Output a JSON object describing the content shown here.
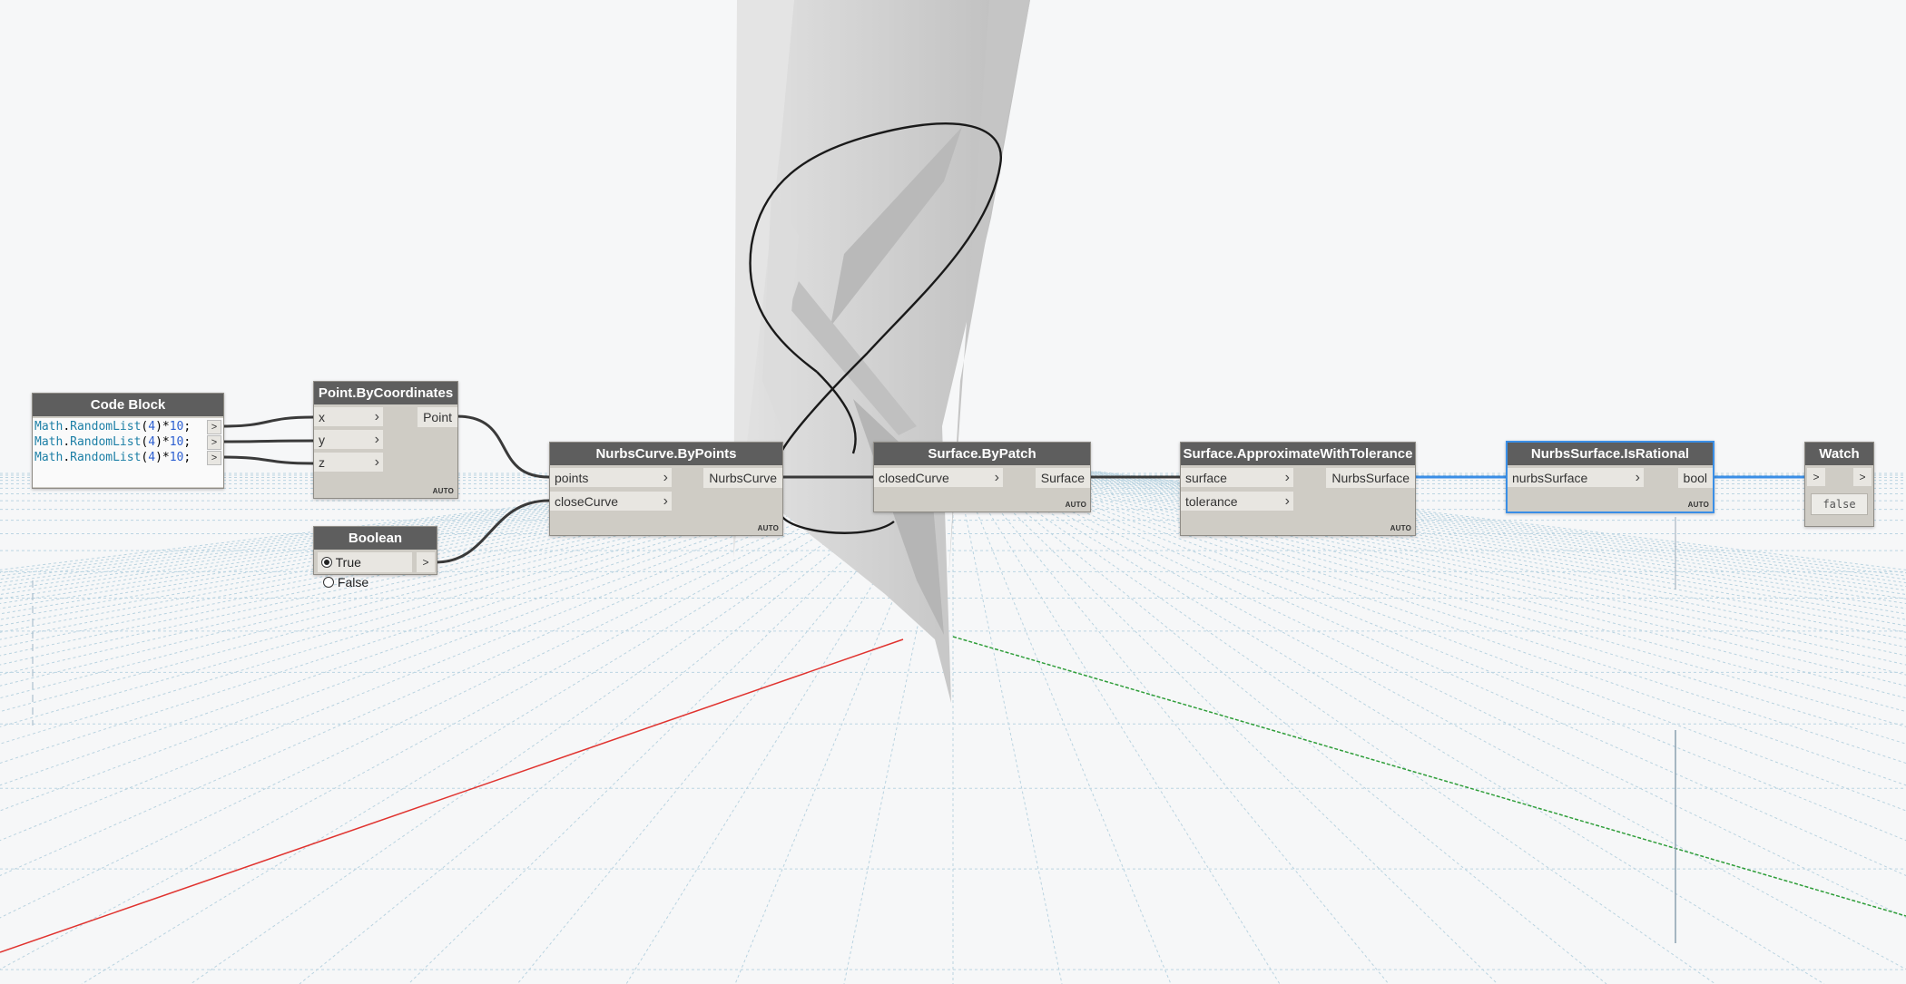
{
  "colors": {
    "node_header": "#5e5e5e",
    "node_body": "#cfccc5",
    "port_fill": "#e8e6e1",
    "wire": "#3a3a3a",
    "selected_wire": "#3a8ee6",
    "code_function": "#1c7fa6",
    "code_number": "#2c5fd1",
    "x_axis": "#e0332f",
    "y_axis": "#2f9e3a",
    "grid": "#9fc3d6"
  },
  "nodes": {
    "code_block": {
      "title": "Code Block",
      "lines": [
        {
          "fn": "Math",
          "dot": ".",
          "method": "RandomList",
          "open": "(",
          "arg": "4",
          "close": ")",
          "op": "*",
          "num": "10",
          "end": ";"
        },
        {
          "fn": "Math",
          "dot": ".",
          "method": "RandomList",
          "open": "(",
          "arg": "4",
          "close": ")",
          "op": "*",
          "num": "10",
          "end": ";"
        },
        {
          "fn": "Math",
          "dot": ".",
          "method": "RandomList",
          "open": "(",
          "arg": "4",
          "close": ")",
          "op": "*",
          "num": "10",
          "end": ";"
        }
      ],
      "output_glyph": ">"
    },
    "point_by_coordinates": {
      "title": "Point.ByCoordinates",
      "inputs": [
        "x",
        "y",
        "z"
      ],
      "output": "Point",
      "lacing": "AUTO"
    },
    "boolean": {
      "title": "Boolean",
      "true_label": "True",
      "false_label": "False",
      "selected": "True",
      "output_glyph": ">"
    },
    "nurbs_curve": {
      "title": "NurbsCurve.ByPoints",
      "inputs": [
        "points",
        "closeCurve"
      ],
      "output": "NurbsCurve",
      "lacing": "AUTO"
    },
    "surface_by_patch": {
      "title": "Surface.ByPatch",
      "inputs": [
        "closedCurve"
      ],
      "output": "Surface",
      "lacing": "AUTO"
    },
    "surface_approx": {
      "title": "Surface.ApproximateWithTolerance",
      "inputs": [
        "surface",
        "tolerance"
      ],
      "output": "NurbsSurface",
      "lacing": "AUTO"
    },
    "is_rational": {
      "title": "NurbsSurface.IsRational",
      "inputs": [
        "nurbsSurface"
      ],
      "output": "bool",
      "lacing": "AUTO"
    },
    "watch": {
      "title": "Watch",
      "input_glyph": ">",
      "output_glyph": ">",
      "value": "false"
    }
  }
}
